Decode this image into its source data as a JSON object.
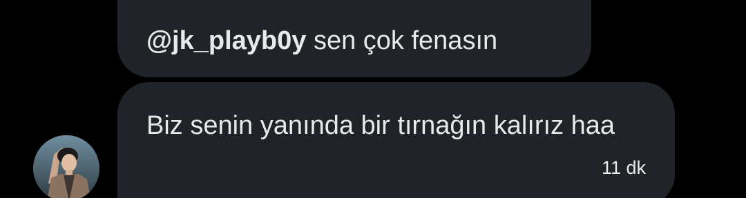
{
  "messages": [
    {
      "mention": "@jk_playb0y",
      "text": " sen çok fenasın"
    },
    {
      "text": "Biz senin yanında bir tırnağın kalırız haa",
      "time": "11 dk"
    }
  ],
  "avatar": {
    "icon": "user-avatar-photo"
  }
}
